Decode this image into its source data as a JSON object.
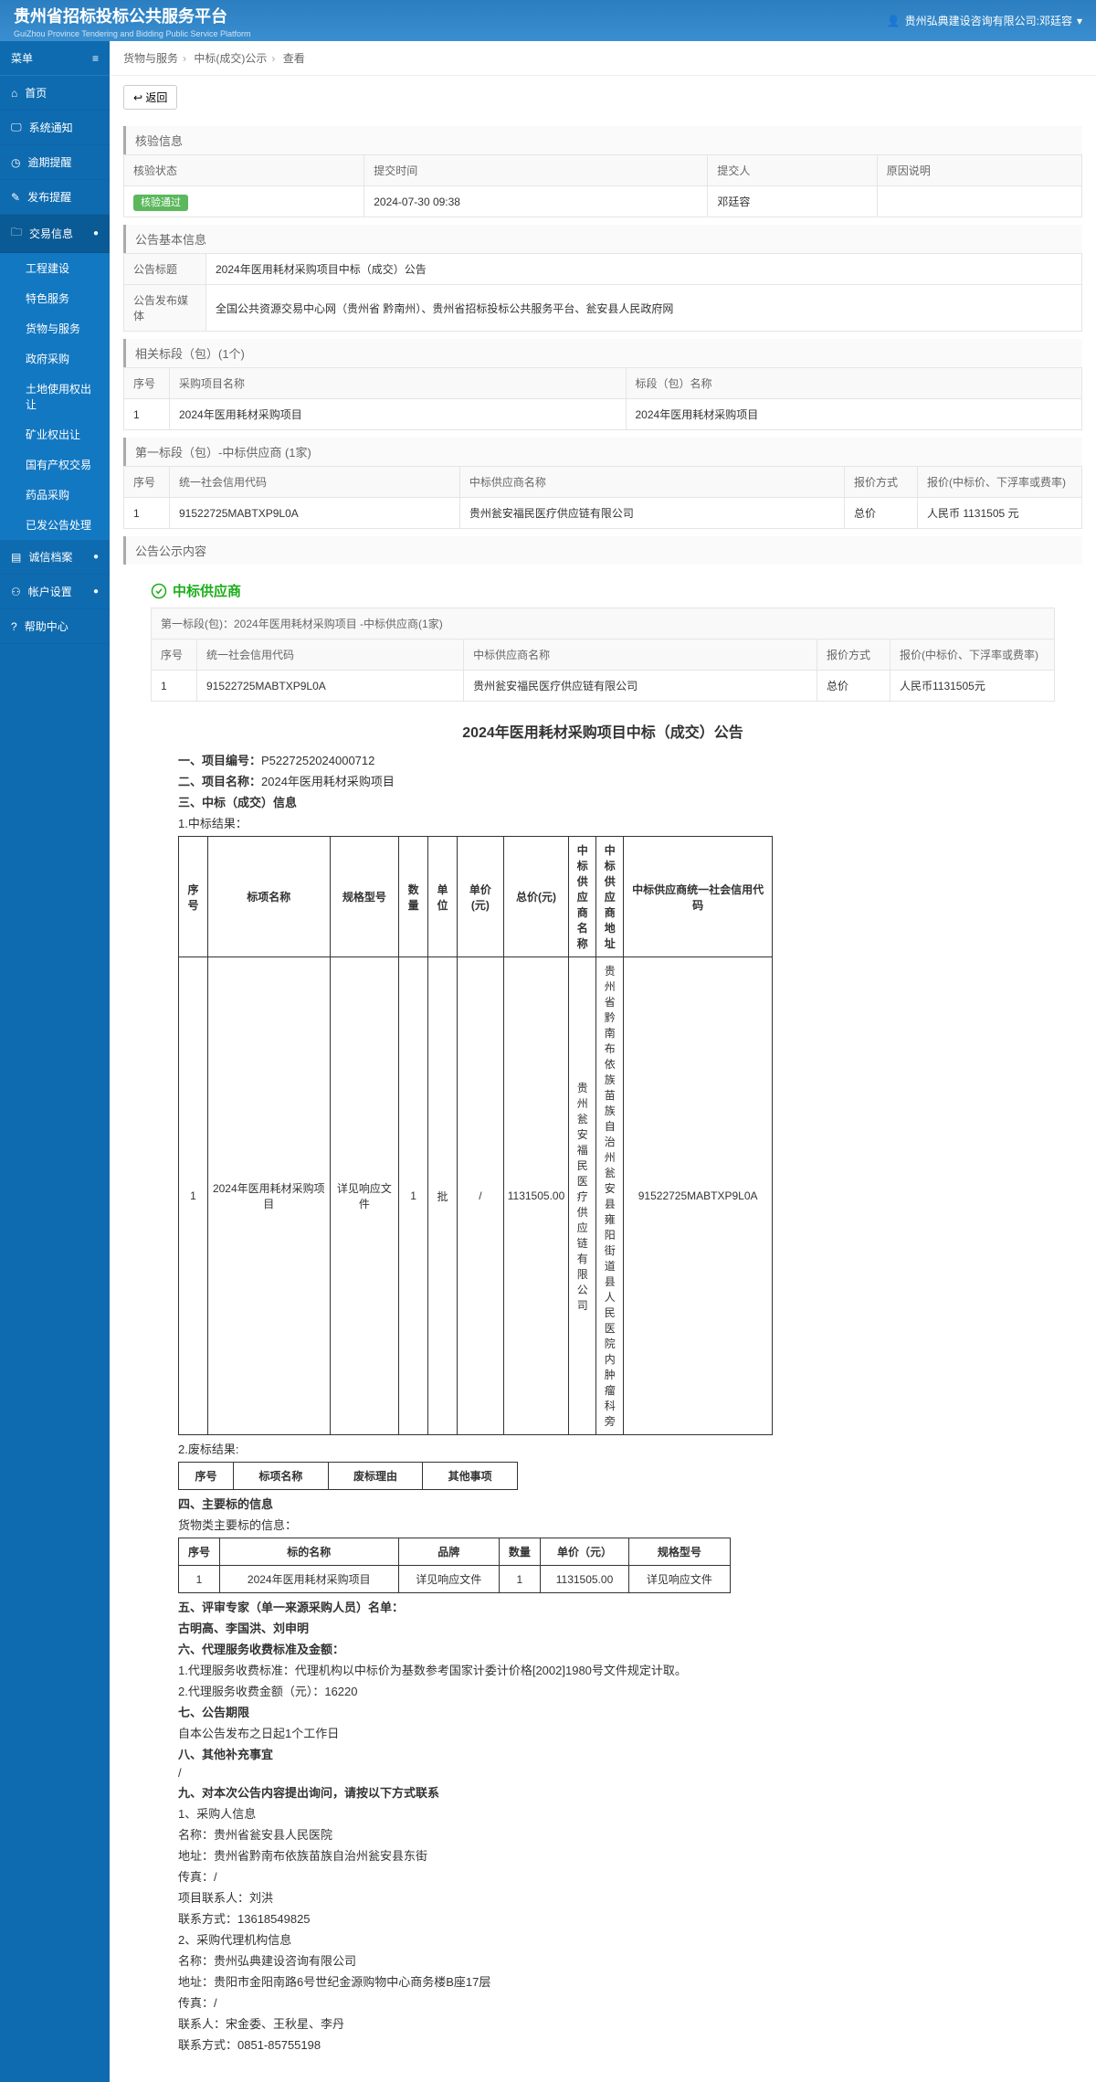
{
  "header": {
    "title": "贵州省招标投标公共服务平台",
    "subtitle": "GuiZhou Province Tendering and Bidding Public Service Platform",
    "user": "贵州弘典建设咨询有限公司:邓廷容"
  },
  "sidebar": {
    "menu_label": "菜单",
    "items": [
      {
        "label": "首页",
        "icon": "home"
      },
      {
        "label": "系统通知",
        "icon": "monitor"
      },
      {
        "label": "逾期提醒",
        "icon": "clock"
      },
      {
        "label": "发布提醒",
        "icon": "bell"
      },
      {
        "label": "交易信息",
        "icon": "folder",
        "expanded": true,
        "children": [
          {
            "label": "工程建设"
          },
          {
            "label": "特色服务"
          },
          {
            "label": "货物与服务"
          },
          {
            "label": "政府采购"
          },
          {
            "label": "土地使用权出让"
          },
          {
            "label": "矿业权出让"
          },
          {
            "label": "国有产权交易"
          },
          {
            "label": "药品采购"
          },
          {
            "label": "已发公告处理"
          }
        ]
      },
      {
        "label": "诚信档案",
        "icon": "file",
        "chev": true
      },
      {
        "label": "帐户设置",
        "icon": "user",
        "chev": true
      },
      {
        "label": "帮助中心",
        "icon": "help"
      }
    ]
  },
  "breadcrumb": {
    "a": "货物与服务",
    "b": "中标(成交)公示",
    "c": "查看"
  },
  "back_label": "返回",
  "verify": {
    "title": "核验信息",
    "h_status": "核验状态",
    "h_time": "提交时间",
    "h_person": "提交人",
    "h_reason": "原因说明",
    "status": "核验通过",
    "time": "2024-07-30 09:38",
    "person": "邓廷容",
    "reason": ""
  },
  "basic": {
    "title": "公告基本信息",
    "l_title": "公告标题",
    "v_title": "2024年医用耗材采购项目中标（成交）公告",
    "l_media": "公告发布媒体",
    "v_media": "全国公共资源交易中心网（贵州省 黔南州）、贵州省招标投标公共服务平台、瓮安县人民政府网"
  },
  "related": {
    "title": "相关标段（包）(1个)",
    "h_no": "序号",
    "h_name": "采购项目名称",
    "h_seg": "标段（包）名称",
    "r_no": "1",
    "r_name": "2024年医用耗材采购项目",
    "r_seg": "2024年医用耗材采购项目"
  },
  "supplier1": {
    "title": "第一标段（包）-中标供应商 (1家)",
    "h_no": "序号",
    "h_code": "统一社会信用代码",
    "h_name": "中标供应商名称",
    "h_method": "报价方式",
    "h_price": "报价(中标价、下浮率或费率)",
    "r_no": "1",
    "r_code": "91522725MABTXP9L0A",
    "r_name": "贵州瓮安福民医疗供应链有限公司",
    "r_method": "总价",
    "r_price": "人民币 1131505 元"
  },
  "content_title": "公告公示内容",
  "supplier_hdr": "中标供应商",
  "supplier2": {
    "title": "第一标段(包)：2024年医用耗材采购项目 -中标供应商(1家)",
    "h_no": "序号",
    "h_code": "统一社会信用代码",
    "h_name": "中标供应商名称",
    "h_method": "报价方式",
    "h_price": "报价(中标价、下浮率或费率)",
    "r_no": "1",
    "r_code": "91522725MABTXP9L0A",
    "r_name": "贵州瓮安福民医疗供应链有限公司",
    "r_method": "总价",
    "r_price": "人民币1131505元"
  },
  "ann": {
    "title": "2024年医用耗材采购项目中标（成交）公告",
    "l1a": "一、项目编号：",
    "l1b": "P5227252024000712",
    "l2a": "二、项目名称：",
    "l2b": "2024年医用耗材采购项目",
    "l3": "三、中标（成交）信息",
    "l3_1": "1.中标结果：",
    "t1": {
      "h1": "序号",
      "h2": "标项名称",
      "h3": "规格型号",
      "h4": "数量",
      "h5": "单位",
      "h6": "单价(元)",
      "h7": "总价(元)",
      "h8": "中标供应商名称",
      "h9": "中标供应商地址",
      "h10": "中标供应商统一社会信用代码",
      "r1": "1",
      "r2": "2024年医用耗材采购项目",
      "r3": "详见响应文件",
      "r4": "1",
      "r5": "批",
      "r6": "/",
      "r7": "1131505.00",
      "r8": "贵州瓮安福民医疗供应链有限公司",
      "r9": "贵州省黔南布依族苗族自治州瓮安县雍阳街道县人民医院内肿瘤科旁",
      "r10": "91522725MABTXP9L0A"
    },
    "l3_2": "2.废标结果:",
    "t2": {
      "h1": "序号",
      "h2": "标项名称",
      "h3": "废标理由",
      "h4": "其他事项"
    },
    "l4": "四、主要标的信息",
    "l4_1": "货物类主要标的信息：",
    "t3": {
      "h1": "序号",
      "h2": "标的名称",
      "h3": "品牌",
      "h4": "数量",
      "h5": "单价（元）",
      "h6": "规格型号",
      "r1": "1",
      "r2": "2024年医用耗材采购项目",
      "r3": "详见响应文件",
      "r4": "1",
      "r5": "1131505.00",
      "r6": "详见响应文件"
    },
    "l5": "五、评审专家（单一来源采购人员）名单：",
    "l5_1": "古明高、李国洪、刘申明",
    "l6": "六、代理服务收费标准及金额：",
    "l6_1": "1.代理服务收费标准：代理机构以中标价为基数参考国家计委计价格[2002]1980号文件规定计取。",
    "l6_2": "2.代理服务收费金额（元）：16220",
    "l7": "七、公告期限",
    "l7_1": "自本公告发布之日起1个工作日",
    "l8": "八、其他补充事宜",
    "l8_1": "/",
    "l9": "九、对本次公告内容提出询问，请按以下方式联系",
    "c1": "1、采购人信息",
    "c1_name": "名称：贵州省瓮安县人民医院",
    "c1_addr": "地址：贵州省黔南布依族苗族自治州瓮安县东街",
    "c1_fax": "传真：/",
    "c1_person": "项目联系人：刘洪",
    "c1_phone": "联系方式：13618549825",
    "c2": "2、采购代理机构信息",
    "c2_name": "名称：贵州弘典建设咨询有限公司",
    "c2_addr": "地址：贵阳市金阳南路6号世纪金源购物中心商务楼B座17层",
    "c2_fax": "传真：/",
    "c2_person": "联系人：宋金委、王秋星、李丹",
    "c2_phone": "联系方式：0851-85755198"
  }
}
